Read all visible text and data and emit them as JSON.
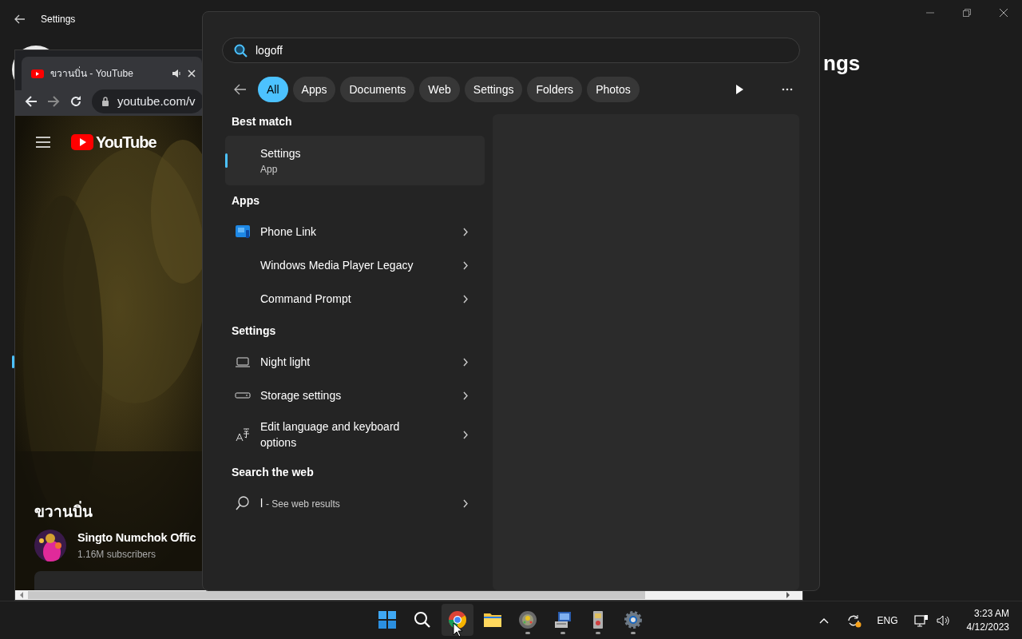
{
  "settings_window": {
    "title": "Settings",
    "heading": "ngs"
  },
  "browser": {
    "tab_title": "ขวานบิ่น - YouTube",
    "address": "youtube.com/v",
    "logo_text": "YouTube",
    "video_title": "ขวานบิ่น",
    "channel": "Singto Numchok Offic",
    "subscribers": "1.16M subscribers"
  },
  "search": {
    "query": "logoff",
    "filters": [
      {
        "label": "All",
        "selected": true
      },
      {
        "label": "Apps",
        "selected": false
      },
      {
        "label": "Documents",
        "selected": false
      },
      {
        "label": "Web",
        "selected": false
      },
      {
        "label": "Settings",
        "selected": false
      },
      {
        "label": "Folders",
        "selected": false
      },
      {
        "label": "Photos",
        "selected": false
      }
    ],
    "sections": [
      {
        "heading": "Best match",
        "items": [
          {
            "kind": "best",
            "title": "Settings",
            "subtitle": "App",
            "selected": true
          }
        ]
      },
      {
        "heading": "Apps",
        "items": [
          {
            "kind": "phone",
            "title": "Phone Link"
          },
          {
            "kind": "blank",
            "title": "Windows Media Player Legacy"
          },
          {
            "kind": "blank",
            "title": "Command Prompt"
          }
        ]
      },
      {
        "heading": "Settings",
        "items": [
          {
            "kind": "laptop",
            "title": "Night light"
          },
          {
            "kind": "drive",
            "title": "Storage settings"
          },
          {
            "kind": "language",
            "title": "Edit language and keyboard options"
          }
        ]
      },
      {
        "heading": "Search the web",
        "items": [
          {
            "kind": "web",
            "title": "l",
            "subtitle": "- See web results"
          }
        ]
      }
    ]
  },
  "taskbar": {
    "apps": [
      {
        "kind": "start",
        "running": false,
        "selected": false
      },
      {
        "kind": "search",
        "running": false,
        "selected": false
      },
      {
        "kind": "chrome",
        "running": false,
        "selected": true
      },
      {
        "kind": "folder",
        "running": false,
        "selected": false
      },
      {
        "kind": "disc",
        "running": true,
        "selected": false
      },
      {
        "kind": "computer",
        "running": true,
        "selected": false
      },
      {
        "kind": "phone",
        "running": true,
        "selected": false
      },
      {
        "kind": "gear",
        "running": true,
        "selected": false
      }
    ],
    "language": "ENG",
    "time": "3:23 AM",
    "date": "4/12/2023"
  }
}
